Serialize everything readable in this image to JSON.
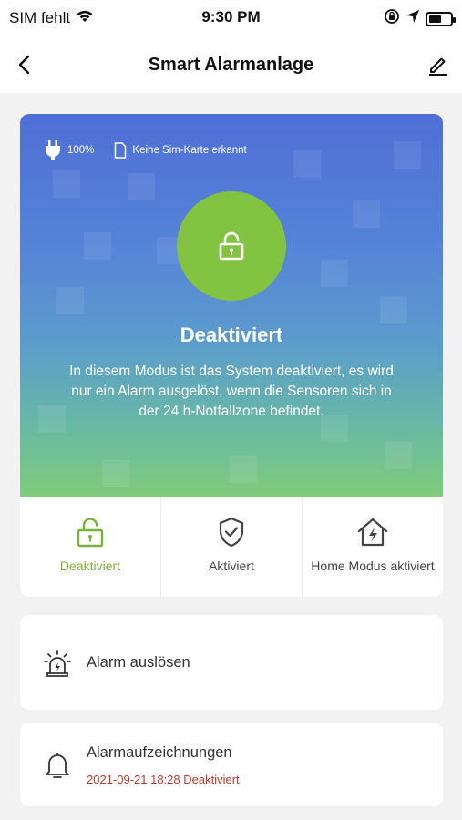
{
  "status_bar": {
    "carrier": "SIM fehlt",
    "time": "9:30 PM",
    "battery_level": 0.6
  },
  "nav": {
    "title": "Smart Alarmanlage"
  },
  "hero": {
    "battery_text": "100%",
    "sim_text": "Keine Sim-Karte erkannt",
    "state_title": "Deaktiviert",
    "description": "In diesem Modus ist das System deaktiviert, es wird  nur ein Alarm ausgelöst, wenn die Sensoren sich in der 24 h-Notfallzone befindet.",
    "accent_color": "#82c341"
  },
  "modes": [
    {
      "label": "Deaktiviert",
      "icon": "unlock-icon",
      "active": true
    },
    {
      "label": "Aktiviert",
      "icon": "shield-check-icon",
      "active": false
    },
    {
      "label": "Home Modus aktiviert",
      "icon": "home-alert-icon",
      "active": false
    }
  ],
  "alarm_card": {
    "label": "Alarm auslösen",
    "icon": "siren-icon"
  },
  "records_card": {
    "label": "Alarmaufzeichnungen",
    "latest": "2021-09-21 18:28 Deaktiviert",
    "icon": "bell-icon",
    "latest_color": "#c0392b"
  }
}
